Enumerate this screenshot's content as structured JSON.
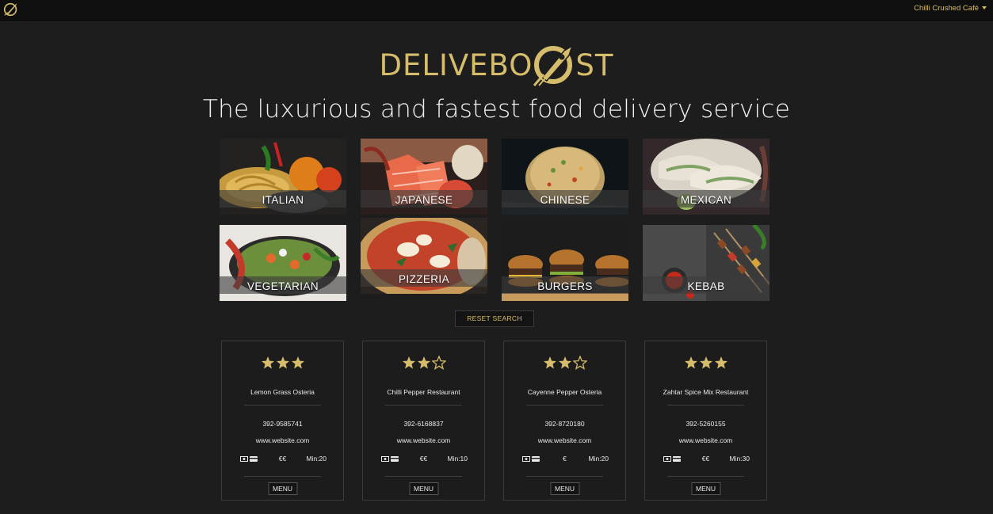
{
  "navbar": {
    "user_label": "Chilli Crushed Café"
  },
  "brand": {
    "part1": "DELIVEBO",
    "part2": "ST",
    "accent_color": "#d6bd6c"
  },
  "tagline": "The luxurious and fastest food delivery service",
  "categories": [
    {
      "label": "ITALIAN"
    },
    {
      "label": "JAPANESE"
    },
    {
      "label": "CHINESE"
    },
    {
      "label": "MEXICAN"
    },
    {
      "label": "VEGETARIAN"
    },
    {
      "label": "PIZZERIA"
    },
    {
      "label": "BURGERS"
    },
    {
      "label": "KEBAB"
    }
  ],
  "reset_label": "RESET SEARCH",
  "restaurants": [
    {
      "name": "Lemon Grass Osteria",
      "rating": 3,
      "phone": "392-9585741",
      "website": "www.website.com",
      "price": "€€",
      "min": "Min:20",
      "menu": "MENU"
    },
    {
      "name": "Chilli Pepper Restaurant",
      "rating": 2,
      "phone": "392-6168837",
      "website": "www.website.com",
      "price": "€€",
      "min": "Min:10",
      "menu": "MENU"
    },
    {
      "name": "Cayenne Pepper Osteria",
      "rating": 2,
      "phone": "392-8720180",
      "website": "www.website.com",
      "price": "€",
      "min": "Min:20",
      "menu": "MENU"
    },
    {
      "name": "Zahtar Spice Mix Restaurant",
      "rating": 3,
      "phone": "392-5260155",
      "website": "www.website.com",
      "price": "€€",
      "min": "Min:30",
      "menu": "MENU"
    }
  ],
  "icons": {
    "payment": [
      "cash-icon",
      "credit-card-icon"
    ],
    "rating": "star-icon"
  }
}
